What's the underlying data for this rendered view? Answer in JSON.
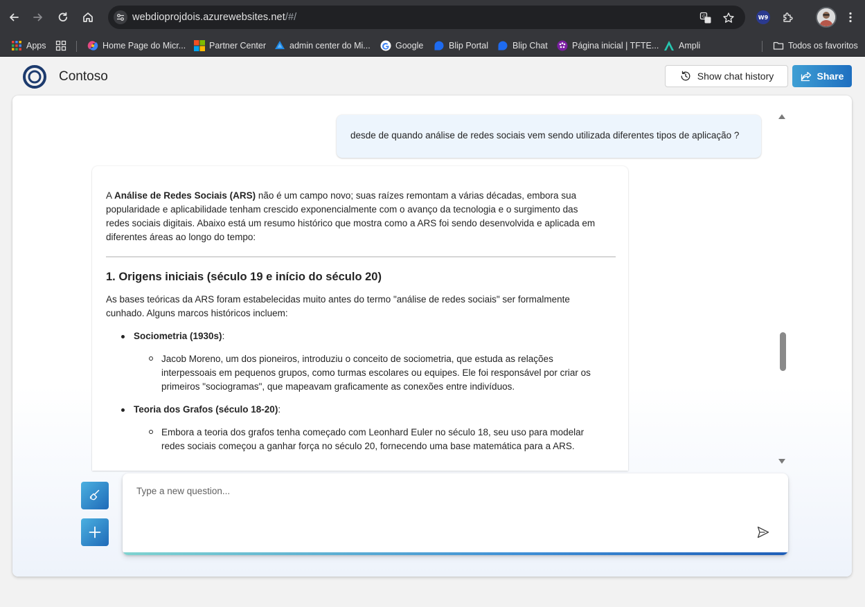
{
  "browser": {
    "url_host": "webdioprojdois.azurewebsites.net",
    "url_path": "/#/",
    "extension_badge": "W9"
  },
  "bookmarks": [
    {
      "label": "Apps",
      "icon": "apps-grid-icon"
    },
    {
      "label": "",
      "icon": "tab-groups-icon"
    },
    {
      "label": "Home Page do Micr...",
      "icon": "copilot-icon"
    },
    {
      "label": "Partner Center",
      "icon": "microsoft-logo-icon"
    },
    {
      "label": "admin center do Mi...",
      "icon": "azure-ad-icon"
    },
    {
      "label": "Google",
      "icon": "google-icon"
    },
    {
      "label": "Blip Portal",
      "icon": "blip-icon"
    },
    {
      "label": "Blip Chat",
      "icon": "blip-icon"
    },
    {
      "label": "Página inicial | TFTE...",
      "icon": "tfte-icon"
    },
    {
      "label": "Ampli",
      "icon": "ampli-icon"
    },
    {
      "label": "Todos os favoritos",
      "icon": "folder-icon"
    }
  ],
  "app": {
    "brand": "Contoso",
    "history_label": "Show chat history",
    "share_label": "Share"
  },
  "chat": {
    "user_question": "desde de quando análise de redes sociais vem sendo utilizada diferentes tipos de aplicação ?",
    "answer": {
      "intro_prefix": "A ",
      "intro_bold": "Análise de Redes Sociais (ARS)",
      "intro_l1": " não é um campo novo; suas raízes remontam a várias décadas, embora sua",
      "intro_l2": "popularidade e aplicabilidade tenham crescido exponencialmente com o avanço da tecnologia e o surgimento das",
      "intro_l3": "redes sociais digitais. Abaixo está um resumo histórico que mostra como a ARS foi sendo desenvolvida e aplicada em",
      "intro_l4": "diferentes áreas ao longo do tempo:",
      "heading": "1. Origens iniciais (século 19 e início do século 20)",
      "para_l1": "As bases teóricas da ARS foram estabelecidas muito antes do termo \"análise de redes sociais\" ser formalmente",
      "para_l2": "cunhado. Alguns marcos históricos incluem:",
      "bullet1_bold": "Sociometria (1930s)",
      "bullet1_colon": ":",
      "sub1_l1": "Jacob Moreno, um dos pioneiros, introduziu o conceito de sociometria, que estuda as relações",
      "sub1_l2": "interpessoais em pequenos grupos, como turmas escolares ou equipes. Ele foi responsável por criar os",
      "sub1_l3": "primeiros \"sociogramas\", que mapeavam graficamente as conexões entre indivíduos.",
      "bullet2_bold": "Teoria dos Grafos (século 18-20)",
      "bullet2_colon": ":",
      "sub2_l1": "Embora a teoria dos grafos tenha começado com Leonhard Euler no século 18, seu uso para modelar",
      "sub2_l2": "redes sociais começou a ganhar força no século 20, fornecendo uma base matemática para a ARS."
    },
    "input_placeholder": "Type a new question...",
    "input_value": ""
  },
  "colors": {
    "accent": "#1f6ab8",
    "accent_light": "#4bb0e0",
    "user_bubble": "#edf5fd",
    "chrome_bg": "#35363a"
  }
}
